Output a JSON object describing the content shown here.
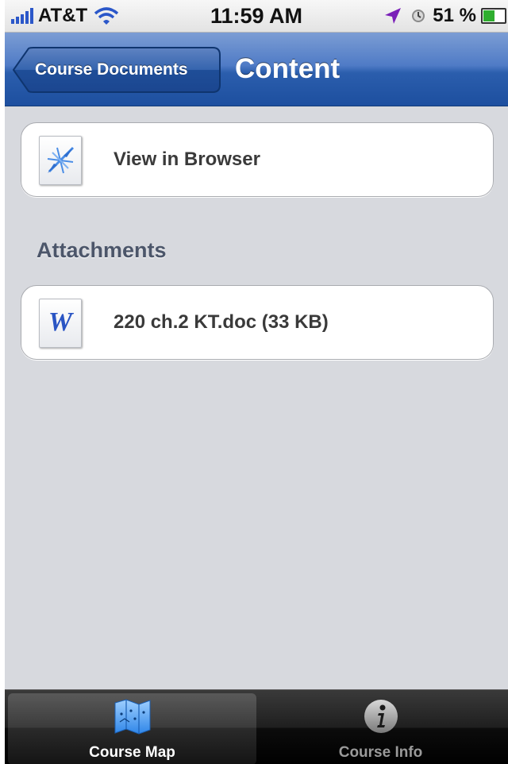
{
  "status_bar": {
    "carrier": "AT&T",
    "time": "11:59 AM",
    "battery": "51 %",
    "icons": [
      "signal-icon",
      "wifi-icon",
      "location-icon",
      "alarm-icon",
      "battery-icon"
    ]
  },
  "nav": {
    "back_label": "Course Documents",
    "title": "Content"
  },
  "content": {
    "browser_cell": {
      "label": "View in Browser",
      "icon": "compass-icon"
    },
    "attachments_header": "Attachments",
    "attachments": [
      {
        "label": "220 ch.2 KT.doc (33 KB)",
        "icon": "word-doc-icon",
        "icon_letter": "W"
      }
    ]
  },
  "tab_bar": {
    "tabs": [
      {
        "label": "Course Map",
        "icon": "map-icon",
        "active": true
      },
      {
        "label": "Course Info",
        "icon": "info-icon",
        "active": false
      }
    ]
  },
  "colors": {
    "nav_blue": "#2b5ead",
    "background": "#d7d9de",
    "section_header": "#4c566a",
    "tab_active_label": "#ffffff",
    "tab_inactive_label": "#9a9a9a"
  }
}
